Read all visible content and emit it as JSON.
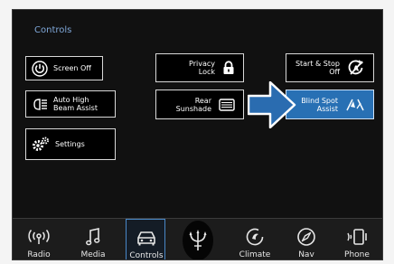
{
  "screen": {
    "title": "Controls"
  },
  "buttons": {
    "screen_off": "Screen Off",
    "auto_high_beam_line1": "Auto High",
    "auto_high_beam_line2": "Beam Assist",
    "settings": "Settings",
    "privacy_lock_line1": "Privacy",
    "privacy_lock_line2": "Lock",
    "rear_sunshade_line1": "Rear",
    "rear_sunshade_line2": "Sunshade",
    "start_stop_line1": "Start & Stop",
    "start_stop_line2": "Off",
    "blind_spot_line1": "Blind Spot",
    "blind_spot_line2": "Assist"
  },
  "dock": {
    "radio": "Radio",
    "media": "Media",
    "controls": "Controls",
    "climate": "Climate",
    "nav": "Nav",
    "phone": "Phone"
  },
  "colors": {
    "accent": "#2870b4",
    "title": "#7fa7d8"
  },
  "icons": [
    "power-icon",
    "headlamp-icon",
    "gears-icon",
    "lock-icon",
    "sunshade-icon",
    "start-stop-off-icon",
    "blind-spot-icon",
    "radio-icon",
    "music-note-icon",
    "car-icon",
    "trident-logo-icon",
    "climate-icon",
    "compass-icon",
    "phone-icon",
    "pointer-arrow-icon"
  ]
}
